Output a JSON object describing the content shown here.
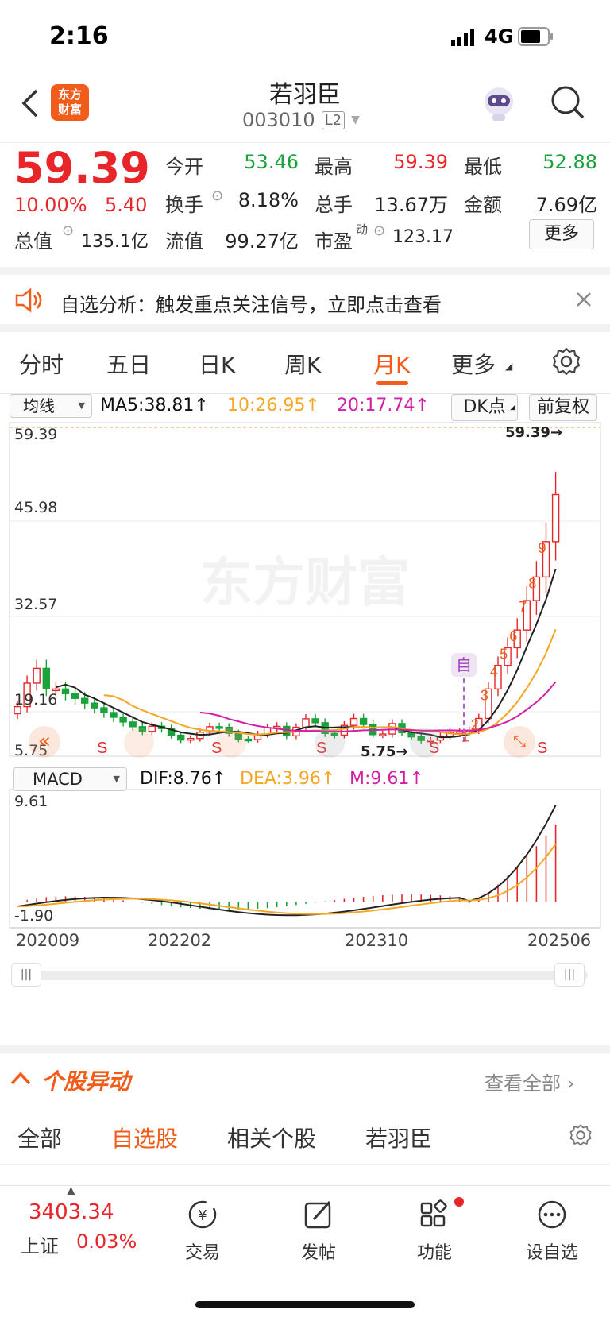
{
  "status": {
    "time": "2:16",
    "network": "4G"
  },
  "header": {
    "logo_line1": "东方",
    "logo_line2": "财富",
    "stock_name": "若羽臣",
    "stock_code": "003010",
    "level": "L2"
  },
  "quote": {
    "price": "59.39",
    "change_pct": "10.00%",
    "change_amt": "5.40",
    "open_label": "今开",
    "open": "53.46",
    "high_label": "最高",
    "high": "59.39",
    "low_label": "最低",
    "low": "52.88",
    "turnover_label": "换手",
    "turnover": "8.18%",
    "volume_label": "总手",
    "volume": "13.67万",
    "amount_label": "金额",
    "amount": "7.69亿",
    "mktcap_label": "总值",
    "mktcap": "135.1亿",
    "float_label": "流值",
    "float": "99.27亿",
    "pe_label": "市盈",
    "pe_sup": "动",
    "pe": "123.17",
    "more_label": "更多"
  },
  "banner": {
    "text": "自选分析：触发重点关注信号，立即点击查看"
  },
  "tabs": [
    "分时",
    "五日",
    "日K",
    "周K",
    "月K",
    "更多"
  ],
  "active_tab": "月K",
  "chart": {
    "ma_select": "均线",
    "ma5": "MA5:38.81↑",
    "ma10": "10:26.95↑",
    "ma20": "20:17.74↑",
    "dk_label": "DK点",
    "adjust_label": "前复权",
    "price_ticks": [
      "59.39",
      "45.98",
      "32.57",
      "19.16",
      "5.75"
    ],
    "max_marker": "59.39→",
    "min_marker": "5.75→",
    "watermark": "东方财富",
    "self_marker": "自",
    "macd_select": "MACD",
    "dif": "DIF:8.76↑",
    "dea": "DEA:3.96↑",
    "m": "M:9.61↑",
    "macd_ticks": [
      "9.61",
      "-1.90"
    ],
    "x_ticks": [
      "202009",
      "202202",
      "202310",
      "202506"
    ],
    "s_label": "S",
    "seq_labels": [
      "1",
      "2",
      "3",
      "4",
      "5",
      "6",
      "7",
      "8",
      "9"
    ]
  },
  "chart_data": {
    "type": "candlestick",
    "period": "monthly",
    "yrange": [
      5.75,
      59.39
    ],
    "x_ticks": [
      "202009",
      "202202",
      "202310",
      "202506"
    ],
    "last_close": 59.39,
    "macd_range": [
      -1.9,
      9.61
    ],
    "dif": 8.76,
    "dea": 3.96,
    "m": 9.61,
    "ma": {
      "ma5": 38.81,
      "ma10": 26.95,
      "ma20": 17.74
    },
    "colors": {
      "up": "#e8262a",
      "down": "#1aa33a",
      "ma5": "#222222",
      "ma10": "#f5a623",
      "ma20": "#d21fa6"
    }
  },
  "section": {
    "title": "个股异动",
    "view_all": "查看全部"
  },
  "subtabs": [
    "全部",
    "自选股",
    "相关个股",
    "若羽臣"
  ],
  "active_subtab": "自选股",
  "bottom": {
    "index_value": "3403.34",
    "index_name": "上证",
    "index_pct": "0.03%",
    "nav": [
      "交易",
      "发帖",
      "功能",
      "设自选"
    ]
  }
}
